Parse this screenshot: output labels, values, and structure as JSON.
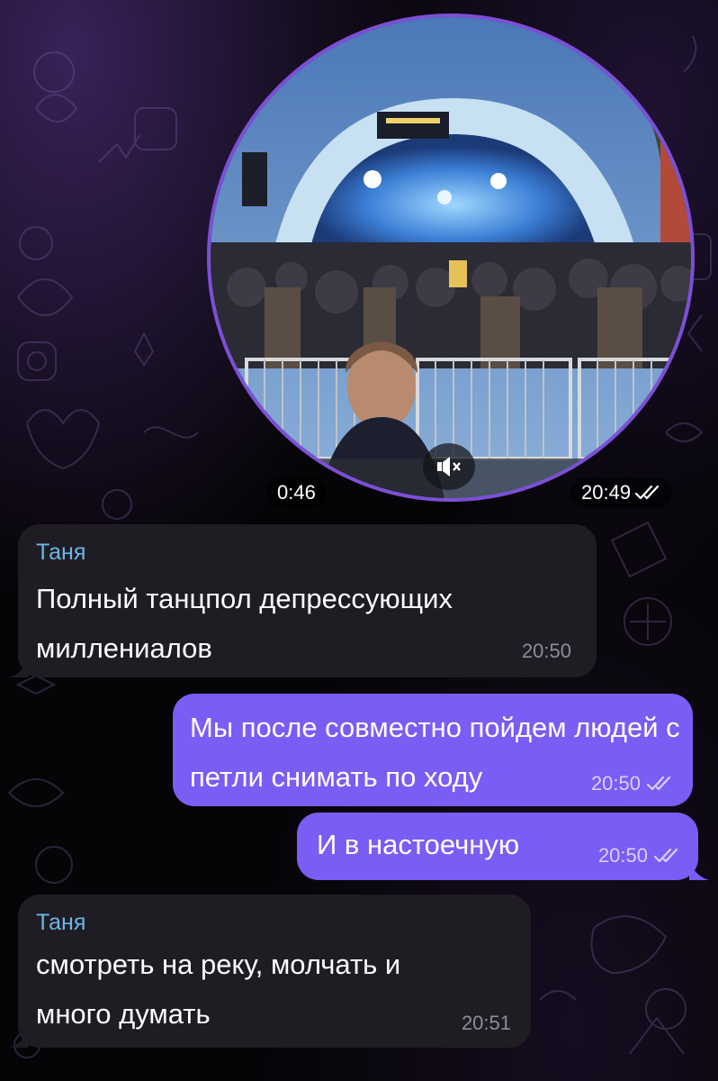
{
  "video_message": {
    "duration": "0:46",
    "time": "20:49",
    "status": "read",
    "muted": true
  },
  "messages": [
    {
      "direction": "in",
      "sender": "Таня",
      "lines": [
        "Полный танцпол депрессующих",
        "миллениалов"
      ],
      "time": "20:50"
    },
    {
      "direction": "out",
      "lines": [
        "Мы после совместно пойдем людей с",
        "петли снимать по ходу"
      ],
      "time": "20:50",
      "status": "read"
    },
    {
      "direction": "out",
      "lines": [
        "И в настоечную"
      ],
      "time": "20:50",
      "status": "read"
    },
    {
      "direction": "in",
      "sender": "Таня",
      "lines": [
        "смотреть на реку, молчать и",
        "много думать"
      ],
      "time": "20:51"
    }
  ],
  "colors": {
    "incoming_bubble": "#1f1c24",
    "outgoing_bubble": "#7b5cf4",
    "sender_name": "#6cb7e6",
    "video_ring": "#7d4fd6"
  }
}
